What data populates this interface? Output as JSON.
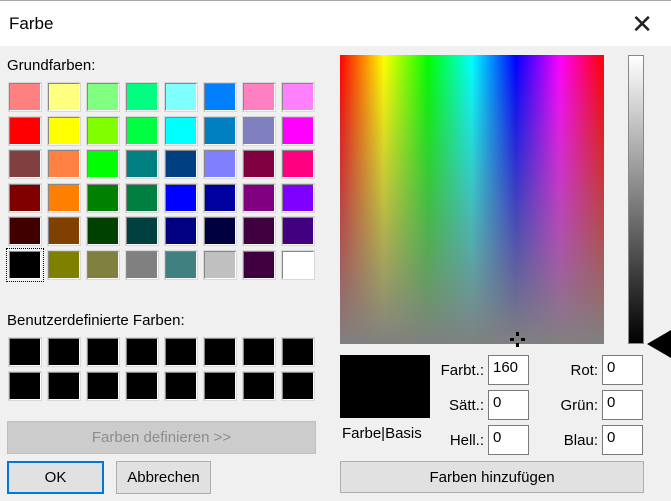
{
  "window": {
    "title": "Farbe",
    "close_label": "✕"
  },
  "basic": {
    "label": "Grundfarben:",
    "colors": [
      [
        "#FF8080",
        "#FFFF80",
        "#80FF80",
        "#00FF80",
        "#80FFFF",
        "#0080FF",
        "#FF80C0",
        "#FF80FF"
      ],
      [
        "#FF0000",
        "#FFFF00",
        "#80FF00",
        "#00FF40",
        "#00FFFF",
        "#0080C0",
        "#8080C0",
        "#FF00FF"
      ],
      [
        "#804040",
        "#FF8040",
        "#00FF00",
        "#008080",
        "#004080",
        "#8080FF",
        "#800040",
        "#FF0080"
      ],
      [
        "#800000",
        "#FF8000",
        "#008000",
        "#008040",
        "#0000FF",
        "#0000A0",
        "#800080",
        "#8000FF"
      ],
      [
        "#400000",
        "#804000",
        "#004000",
        "#004040",
        "#000080",
        "#000040",
        "#400040",
        "#400080"
      ],
      [
        "#000000",
        "#808000",
        "#808040",
        "#808080",
        "#408080",
        "#C0C0C0",
        "#400040",
        "#FFFFFF"
      ]
    ],
    "selected": [
      5,
      0
    ]
  },
  "custom": {
    "label": "Benutzerdefinierte Farben:",
    "colors": [
      [
        "#000000",
        "#000000",
        "#000000",
        "#000000",
        "#000000",
        "#000000",
        "#000000",
        "#000000"
      ],
      [
        "#000000",
        "#000000",
        "#000000",
        "#000000",
        "#000000",
        "#000000",
        "#000000",
        "#000000"
      ]
    ]
  },
  "buttons": {
    "define": "Farben definieren >>",
    "ok": "OK",
    "cancel": "Abbrechen",
    "add": "Farben hinzufügen"
  },
  "preview": {
    "label": "Farbe|Basis",
    "color": "#000000"
  },
  "fields": {
    "hue_label": "Farbt.:",
    "hue": "160",
    "sat_label": "Sätt.:",
    "sat": "0",
    "lum_label": "Hell.:",
    "lum": "0",
    "red_label": "Rot:",
    "red": "0",
    "green_label": "Grün:",
    "green": "0",
    "blue_label": "Blau:",
    "blue": "0"
  }
}
